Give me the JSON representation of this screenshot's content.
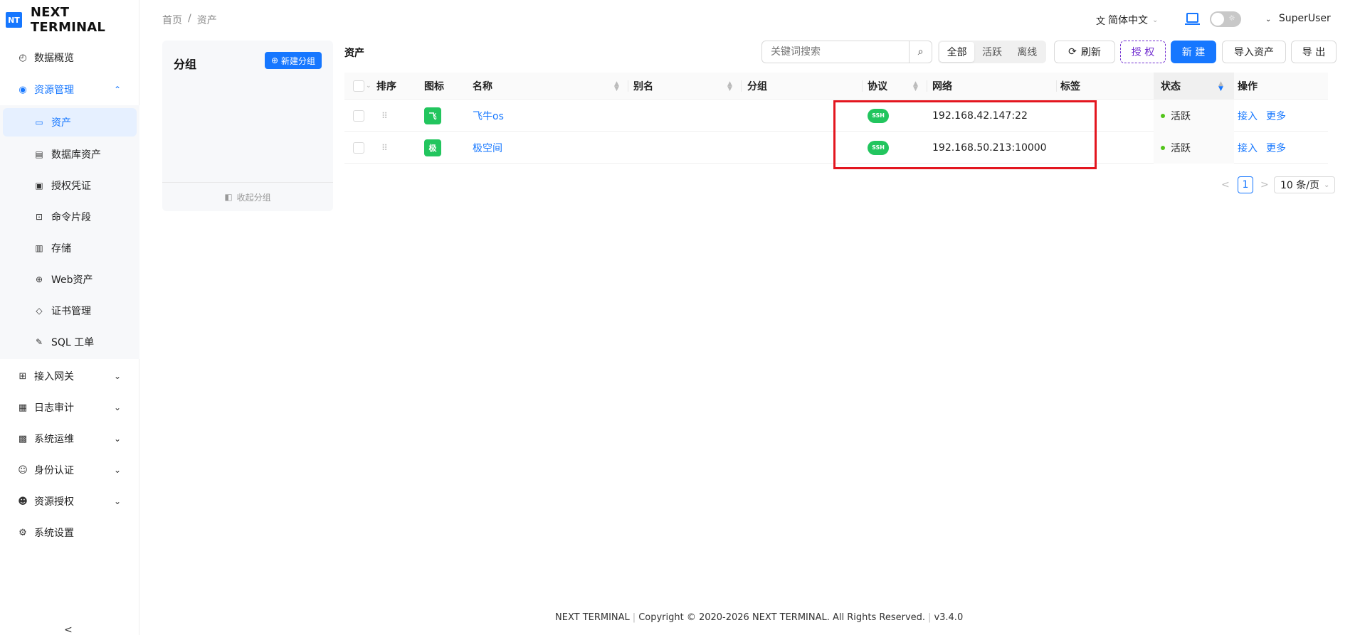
{
  "brand": {
    "logo": "NT",
    "name": "NEXT TERMINAL"
  },
  "nav": {
    "items": [
      {
        "label": "数据概览",
        "icon": "dashboard-icon"
      },
      {
        "label": "资源管理",
        "icon": "cloud-icon"
      },
      {
        "label": "接入网关",
        "icon": "gateway-icon"
      },
      {
        "label": "日志审计",
        "icon": "audit-icon"
      },
      {
        "label": "系统运维",
        "icon": "ops-icon"
      },
      {
        "label": "身份认证",
        "icon": "user-auth-icon"
      },
      {
        "label": "资源授权",
        "icon": "user-grant-icon"
      },
      {
        "label": "系统设置",
        "icon": "gear-icon"
      }
    ],
    "sub_items": [
      {
        "label": "资产",
        "icon": "monitor-icon"
      },
      {
        "label": "数据库资产",
        "icon": "database-icon"
      },
      {
        "label": "授权凭证",
        "icon": "credential-icon"
      },
      {
        "label": "命令片段",
        "icon": "terminal-icon"
      },
      {
        "label": "存储",
        "icon": "storage-icon"
      },
      {
        "label": "Web资产",
        "icon": "globe-icon"
      },
      {
        "label": "证书管理",
        "icon": "shield-icon"
      },
      {
        "label": "SQL 工单",
        "icon": "edit-icon"
      }
    ],
    "collapse_glyph": "<"
  },
  "breadcrumb": {
    "home": "首页",
    "separator": "/",
    "current": "资产"
  },
  "header": {
    "language": "简体中文",
    "user": "SuperUser"
  },
  "group_panel": {
    "title": "分组",
    "new_button": "新建分组",
    "collapse": "收起分组"
  },
  "assets": {
    "title": "资产",
    "search_placeholder": "关键词搜索",
    "filters": [
      "全部",
      "活跃",
      "离线"
    ],
    "buttons": {
      "refresh": "刷新",
      "authorize": "授 权",
      "new": "新 建",
      "import": "导入资产",
      "export": "导 出"
    },
    "columns": {
      "sort": "排序",
      "icon": "图标",
      "name": "名称",
      "alias": "别名",
      "group": "分组",
      "protocol": "协议",
      "network": "网络",
      "tags": "标签",
      "status": "状态",
      "actions": "操作"
    },
    "rows": [
      {
        "icon_text": "飞",
        "name": "飞牛os",
        "alias": "",
        "group": "",
        "protocol": "SSH",
        "network": "192.168.42.147:22",
        "tags": "",
        "status": "活跃",
        "action1": "接入",
        "action2": "更多"
      },
      {
        "icon_text": "极",
        "name": "极空间",
        "alias": "",
        "group": "",
        "protocol": "SSH",
        "network": "192.168.50.213:10000",
        "tags": "",
        "status": "活跃",
        "action1": "接入",
        "action2": "更多"
      }
    ],
    "pagination": {
      "prev": "<",
      "current_page": "1",
      "next": ">",
      "page_size": "10 条/页"
    }
  },
  "colors": {
    "primary": "#1677ff",
    "success": "#22c55e",
    "highlight_box": "#e3161f",
    "purple": "#722ed1"
  },
  "footer": {
    "brand": "NEXT TERMINAL",
    "copyright": "Copyright © 2020-2026 NEXT TERMINAL. All Rights Reserved.",
    "version": "v3.4.0"
  }
}
